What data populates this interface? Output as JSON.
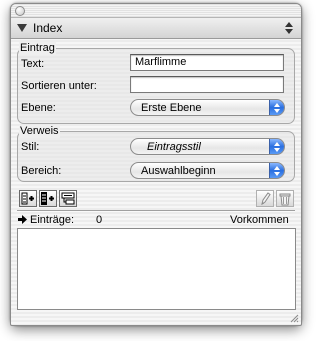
{
  "palette": {
    "tab_title": "Index"
  },
  "eintrag": {
    "group_title": "Eintrag",
    "text_label": "Text:",
    "text_value": "Marflimme",
    "sort_label": "Sortieren unter:",
    "sort_value": "",
    "level_label": "Ebene:",
    "level_value": "Erste Ebene"
  },
  "verweis": {
    "group_title": "Verweis",
    "style_label": "Stil:",
    "style_value": "Eintragsstil",
    "range_label": "Bereich:",
    "range_value": "Auswahlbeginn"
  },
  "toolbar": {
    "left_icons": [
      "add-entry-icon",
      "add-all-entries-icon",
      "find-entry-icon"
    ],
    "right_icons": [
      "edit-pencil-icon",
      "trash-icon"
    ]
  },
  "list": {
    "entries_label": "Einträge:",
    "entries_count": "0",
    "occurrences_label": "Vorkommen"
  },
  "colors": {
    "popup_arrow_blue": "#2a6fe0"
  }
}
